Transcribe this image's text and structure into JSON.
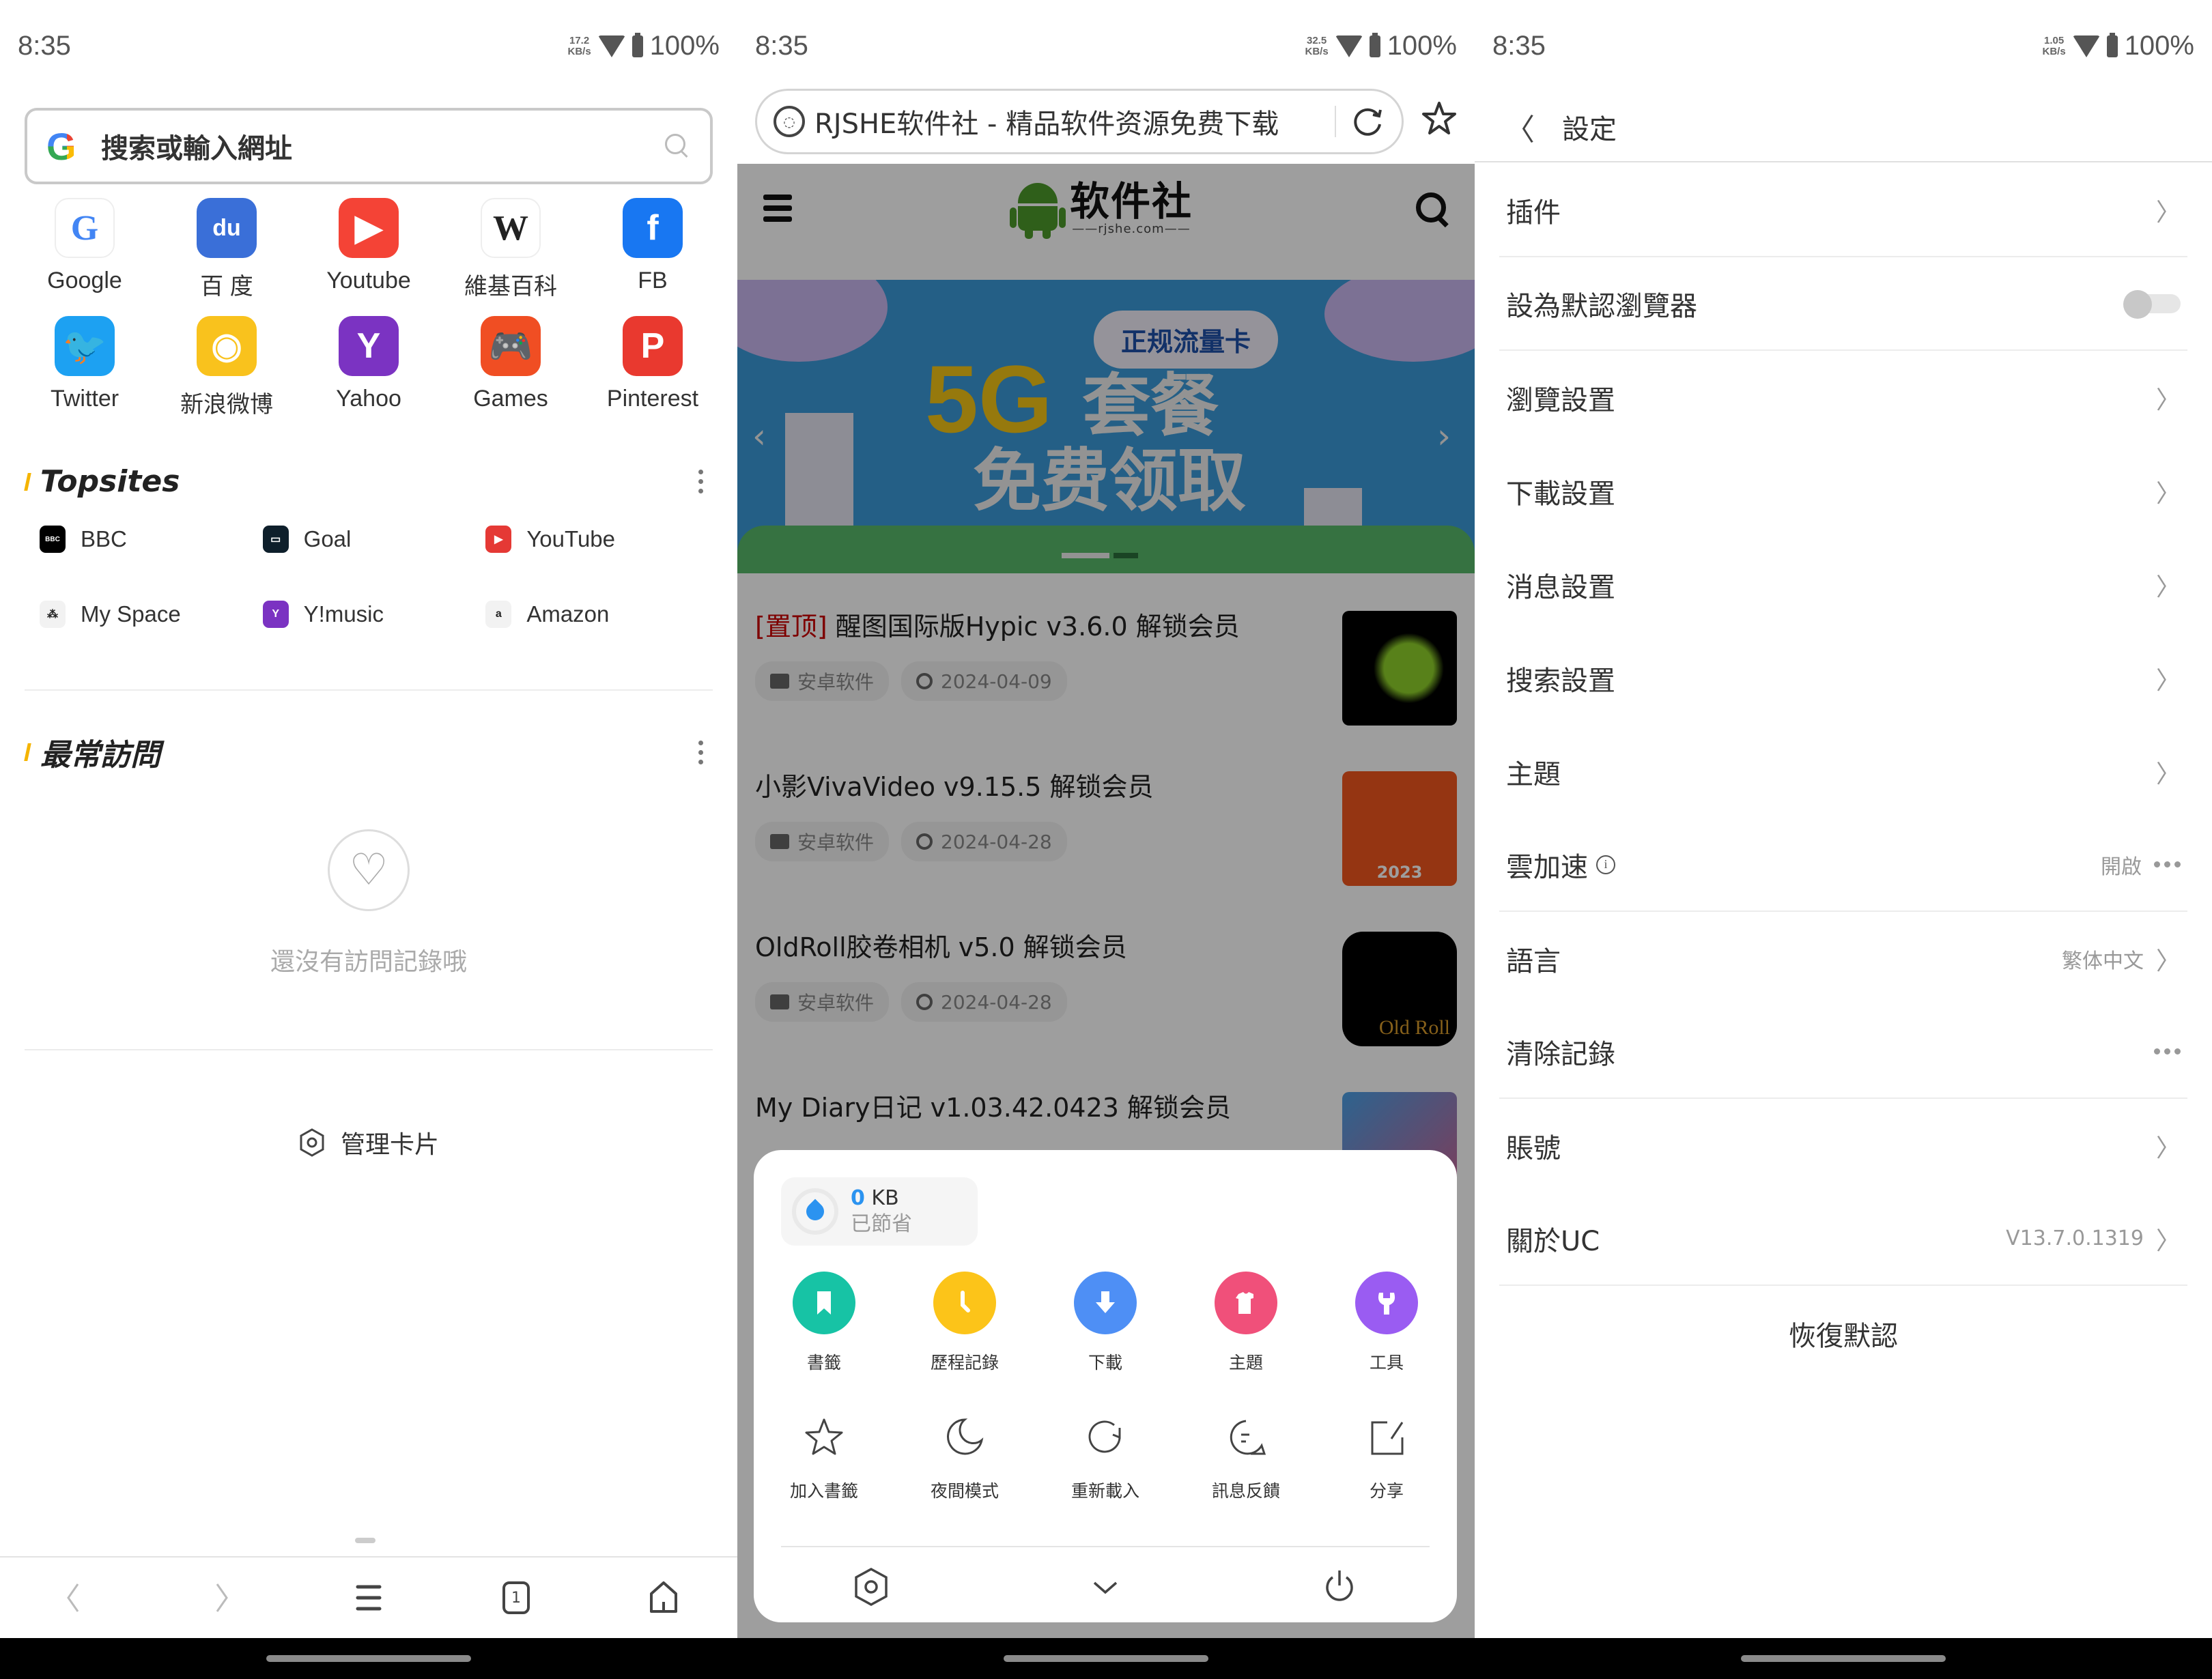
{
  "status_bars": [
    {
      "time": "8:35",
      "net_speed": "17.2",
      "net_unit": "KB/s",
      "battery": "100%"
    },
    {
      "time": "8:35",
      "net_speed": "32.5",
      "net_unit": "KB/s",
      "battery": "100%"
    },
    {
      "time": "8:35",
      "net_speed": "1.05",
      "net_unit": "KB/s",
      "battery": "100%"
    }
  ],
  "home": {
    "search_placeholder": "搜索或輸入網址",
    "shortcuts": [
      {
        "label": "Google",
        "icon": "google-icon",
        "color": "#ffffff",
        "glyph": "G"
      },
      {
        "label": "百 度",
        "icon": "baidu-icon",
        "color": "#3a6fd8",
        "glyph": "du"
      },
      {
        "label": "Youtube",
        "icon": "youtube-icon",
        "color": "#f44336",
        "glyph": "▶"
      },
      {
        "label": "維基百科",
        "icon": "wikipedia-icon",
        "color": "#ffffff",
        "glyph": "W"
      },
      {
        "label": "FB",
        "icon": "facebook-icon",
        "color": "#1877f2",
        "glyph": "f"
      },
      {
        "label": "Twitter",
        "icon": "twitter-icon",
        "color": "#1da1f2",
        "glyph": "🐦"
      },
      {
        "label": "新浪微博",
        "icon": "weibo-icon",
        "color": "#f9c21d",
        "glyph": "◉"
      },
      {
        "label": "Yahoo",
        "icon": "yahoo-icon",
        "color": "#7b33c2",
        "glyph": "Y"
      },
      {
        "label": "Games",
        "icon": "games-icon",
        "color": "#f04e23",
        "glyph": "🎮"
      },
      {
        "label": "Pinterest",
        "icon": "pinterest-icon",
        "color": "#e9392f",
        "glyph": "P"
      }
    ],
    "topsites_title": "Topsites",
    "topsites": [
      {
        "label": "BBC",
        "icon": "bbc-icon",
        "color": "#000000",
        "glyph": "BBC"
      },
      {
        "label": "Goal",
        "icon": "goal-icon",
        "color": "#0e1f2b",
        "glyph": "▭"
      },
      {
        "label": "YouTube",
        "icon": "youtube-small-icon",
        "color": "#e53935",
        "glyph": "▶"
      },
      {
        "label": "My Space",
        "icon": "myspace-icon",
        "color": "#f2f2f2",
        "glyph": "⁂"
      },
      {
        "label": "Y!music",
        "icon": "ymusic-icon",
        "color": "#7b33c2",
        "glyph": "Y"
      },
      {
        "label": "Amazon",
        "icon": "amazon-icon",
        "color": "#f2f2f2",
        "glyph": "a"
      }
    ],
    "frequent_title": "最常訪問",
    "empty_text": "還沒有訪問記錄哦",
    "manage_label": "管理卡片",
    "tab_count": "1"
  },
  "browser": {
    "page_title": "RJSHE软件社 - 精品软件资源免费下载",
    "site_logo_text": "软件社",
    "site_logo_sub": "——rjshe.com——",
    "banner": {
      "bubble": "正规流量卡",
      "big": "5G",
      "line1": "套餐",
      "line2": "免费领取"
    },
    "articles": [
      {
        "pin": "[置顶]",
        "title": " 醒图国际版Hypic v3.6.0 解锁会员",
        "category": "安卓软件",
        "date": "2024-04-09",
        "thumb": "hypic"
      },
      {
        "pin": "",
        "title": "小影VivaVideo v9.15.5 解锁会员",
        "category": "安卓软件",
        "date": "2024-04-28",
        "thumb": "vivavideo",
        "thumb_caption": "2023"
      },
      {
        "pin": "",
        "title": "OldRoll胶卷相机 v5.0 解锁会员",
        "category": "安卓软件",
        "date": "2024-04-28",
        "thumb": "oldroll",
        "thumb_caption": "Old Roll"
      },
      {
        "pin": "",
        "title": "My Diary日记 v1.03.42.0423 解锁会员",
        "category": "",
        "date": "",
        "thumb": "mydiary"
      }
    ],
    "menu": {
      "saved_value": "0",
      "saved_unit": " KB",
      "saved_label": "已節省",
      "primary": [
        {
          "label": "書籤",
          "icon": "bookmark-icon",
          "color": "#17c3a5"
        },
        {
          "label": "歷程記錄",
          "icon": "history-icon",
          "color": "#fcc419"
        },
        {
          "label": "下載",
          "icon": "download-icon",
          "color": "#4e8ff5"
        },
        {
          "label": "主題",
          "icon": "theme-icon",
          "color": "#f0507a"
        },
        {
          "label": "工具",
          "icon": "tools-icon",
          "color": "#9a5cf2"
        }
      ],
      "secondary": [
        {
          "label": "加入書籤",
          "icon": "add-bookmark-icon"
        },
        {
          "label": "夜間模式",
          "icon": "night-mode-icon"
        },
        {
          "label": "重新載入",
          "icon": "reload-icon"
        },
        {
          "label": "訊息反饋",
          "icon": "feedback-icon"
        },
        {
          "label": "分享",
          "icon": "share-icon"
        }
      ]
    }
  },
  "settings": {
    "title": "設定",
    "items": [
      {
        "label": "插件",
        "type": "chevron",
        "divider": true
      },
      {
        "label": "設為默認瀏覽器",
        "type": "toggle",
        "toggle_on": false,
        "divider": true
      },
      {
        "label": "瀏覽設置",
        "type": "chevron",
        "divider": false
      },
      {
        "label": "下載設置",
        "type": "chevron",
        "divider": false
      },
      {
        "label": "消息設置",
        "type": "chevron",
        "divider": false
      },
      {
        "label": "搜索設置",
        "type": "chevron",
        "divider": false
      },
      {
        "label": "主題",
        "type": "chevron",
        "divider": false
      },
      {
        "label": "雲加速",
        "type": "dots",
        "value": "開啟",
        "info": true,
        "divider": true
      },
      {
        "label": "語言",
        "type": "chevron",
        "value": "繁体中文",
        "divider": false
      },
      {
        "label": "清除記錄",
        "type": "dots",
        "divider": true
      },
      {
        "label": "賬號",
        "type": "chevron",
        "divider": false
      },
      {
        "label": "關於UC",
        "type": "chevron",
        "value": "V13.7.0.1319",
        "divider": true
      }
    ],
    "restore_label": "恢復默認"
  }
}
